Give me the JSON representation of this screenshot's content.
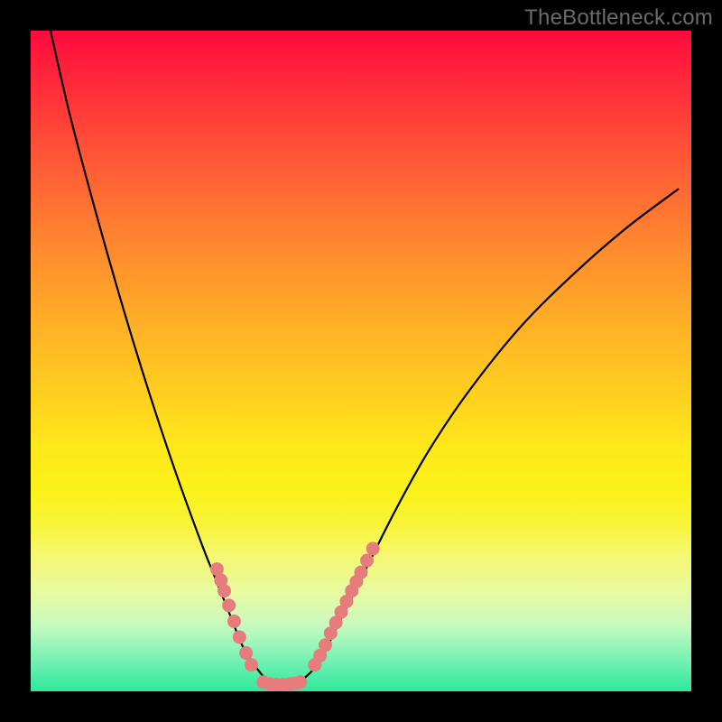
{
  "watermark": "TheBottleneck.com",
  "colors": {
    "curve_stroke": "#000000",
    "dot_fill": "#e77c7c",
    "dot_stroke": "#d86a6a",
    "bg_black": "#000000"
  },
  "chart_data": {
    "type": "line",
    "title": "",
    "xlabel": "",
    "ylabel": "",
    "xlim": [
      0,
      100
    ],
    "ylim": [
      0,
      100
    ],
    "grid": false,
    "series": [
      {
        "name": "bottleneck-curve",
        "x": [
          3,
          6,
          10,
          14,
          18,
          22,
          26,
          28,
          30,
          32,
          33.5,
          35,
          36,
          37,
          38,
          40,
          42,
          44,
          46,
          50,
          55,
          60,
          66,
          74,
          82,
          90,
          98
        ],
        "y": [
          100,
          87,
          72,
          58,
          45,
          33,
          22,
          17,
          12,
          7,
          4.5,
          2.5,
          1.5,
          1,
          1,
          1.2,
          2.5,
          5,
          9,
          17,
          27,
          36,
          45,
          55,
          63,
          70,
          76
        ]
      }
    ],
    "annotations": {
      "highlight_dots_left": [
        {
          "x": 28.2,
          "y": 18.5
        },
        {
          "x": 28.8,
          "y": 16.8
        },
        {
          "x": 29.3,
          "y": 15.2
        },
        {
          "x": 30.0,
          "y": 13.0
        },
        {
          "x": 30.8,
          "y": 10.6
        },
        {
          "x": 31.6,
          "y": 8.2
        },
        {
          "x": 32.6,
          "y": 5.8
        },
        {
          "x": 33.4,
          "y": 4.0
        }
      ],
      "highlight_dots_bottom": [
        {
          "x": 35.2,
          "y": 1.4
        },
        {
          "x": 36.2,
          "y": 1.1
        },
        {
          "x": 37.2,
          "y": 1.0
        },
        {
          "x": 38.2,
          "y": 1.0
        },
        {
          "x": 39.2,
          "y": 1.1
        },
        {
          "x": 40.0,
          "y": 1.2
        },
        {
          "x": 40.8,
          "y": 1.4
        }
      ],
      "highlight_dots_right": [
        {
          "x": 43.0,
          "y": 4.0
        },
        {
          "x": 43.8,
          "y": 5.4
        },
        {
          "x": 44.6,
          "y": 7.0
        },
        {
          "x": 45.4,
          "y": 8.8
        },
        {
          "x": 46.2,
          "y": 10.4
        },
        {
          "x": 47.0,
          "y": 12.0
        },
        {
          "x": 47.8,
          "y": 13.6
        },
        {
          "x": 48.6,
          "y": 15.2
        },
        {
          "x": 49.3,
          "y": 16.6
        },
        {
          "x": 50.0,
          "y": 18.0
        },
        {
          "x": 50.9,
          "y": 19.8
        },
        {
          "x": 51.8,
          "y": 21.6
        }
      ]
    }
  }
}
